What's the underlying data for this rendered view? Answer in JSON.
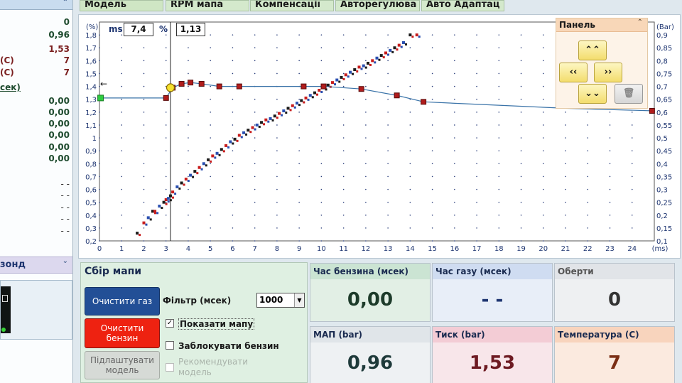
{
  "sidebar": {
    "rows": [
      {
        "label": "",
        "value": "0",
        "color": "#1e4b2e"
      },
      {
        "label": "",
        "value": "0,96",
        "color": "#1e4b2e"
      },
      {
        "label": "",
        "value": "1,53",
        "color": "#7a1f1f"
      },
      {
        "label": "(C)",
        "value": "7",
        "color": "#7a1f1f"
      },
      {
        "label": "(C)",
        "value": "7",
        "color": "#7a1f1f"
      },
      {
        "label": "сек)",
        "value": "",
        "color": "#1e4b2e"
      },
      {
        "label": "",
        "value": "0,00",
        "color": "#1e4b2e"
      },
      {
        "label": "",
        "value": "0,00",
        "color": "#1e4b2e"
      },
      {
        "label": "",
        "value": "0,00",
        "color": "#1e4b2e"
      },
      {
        "label": "",
        "value": "0,00",
        "color": "#1e4b2e"
      },
      {
        "label": "",
        "value": "0,00",
        "color": "#1e4b2e"
      },
      {
        "label": "",
        "value": "0,00",
        "color": "#1e4b2e"
      },
      {
        "label": "",
        "value": "- -",
        "color": "#333333"
      },
      {
        "label": "",
        "value": "- -",
        "color": "#333333"
      },
      {
        "label": "",
        "value": "- -",
        "color": "#333333"
      },
      {
        "label": "",
        "value": "- -",
        "color": "#333333"
      },
      {
        "label": "",
        "value": "- -",
        "color": "#333333"
      }
    ],
    "sonde_title": "зонд"
  },
  "tabs": [
    "Модель",
    "RPM мапа",
    "Компенсації",
    "Авторегулюва",
    "Авто Адаптац"
  ],
  "readout": {
    "ms_label": "ms",
    "ms_value": "7,4",
    "pct_label": "%",
    "pct_value": "1,13"
  },
  "panel": {
    "title": "Панель",
    "up": "⌃⌃",
    "left": "‹‹",
    "right": "››",
    "down": "⌄⌄",
    "trash": "🗑"
  },
  "chart_data": {
    "type": "scatter",
    "xlabel": "(ms)",
    "ylabel_left": "(%)",
    "ylabel_right": "(Bar)",
    "xlim": [
      0,
      25
    ],
    "ylim_left": [
      0.2,
      1.9
    ],
    "ylim_right": [
      0.1,
      0.95
    ],
    "x_ticks": [
      "0",
      "1",
      "2",
      "3",
      "4",
      "5",
      "6",
      "7",
      "8",
      "9",
      "10",
      "11",
      "12",
      "13",
      "14",
      "15",
      "16",
      "17",
      "18",
      "19",
      "20",
      "21",
      "22",
      "23",
      "24"
    ],
    "y_ticks_left": [
      "0,2",
      "0,3",
      "0,4",
      "0,5",
      "0,6",
      "0,7",
      "0,8",
      "0,9",
      "1",
      "1,1",
      "1,2",
      "1,3",
      "1,4",
      "1,5",
      "1,6",
      "1,7",
      "1,8"
    ],
    "y_ticks_right": [
      "0,1",
      "0,15",
      "0,2",
      "0,25",
      "0,3",
      "0,35",
      "0,4",
      "0,45",
      "0,5",
      "0,55",
      "0,6",
      "0,65",
      "0,7",
      "0,75",
      "0,8",
      "0,85",
      "0,9"
    ],
    "cursor": {
      "x": 3.2,
      "y": 1.39
    },
    "grid": true,
    "correction_line": {
      "x": [
        0,
        3.0,
        3.3,
        3.7,
        4.1,
        4.6,
        5.4,
        6.3,
        9.2,
        10.1,
        11.8,
        13.4,
        14.6,
        21.0,
        25.0
      ],
      "y": [
        1.31,
        1.31,
        1.39,
        1.42,
        1.43,
        1.42,
        1.4,
        1.4,
        1.4,
        1.4,
        1.38,
        1.33,
        1.28,
        1.23,
        1.21
      ]
    },
    "correction_points": {
      "x": [
        0.05,
        3.0,
        3.3,
        3.7,
        4.1,
        4.6,
        5.4,
        6.3,
        9.2,
        10.1,
        11.8,
        13.4,
        14.6,
        24.9
      ],
      "y": [
        1.31,
        1.31,
        1.39,
        1.42,
        1.43,
        1.42,
        1.4,
        1.4,
        1.4,
        1.4,
        1.38,
        1.33,
        1.28,
        1.21
      ]
    },
    "map_points": {
      "x": [
        1.7,
        2.0,
        2.2,
        2.4,
        2.5,
        2.7,
        2.9,
        3.0,
        3.1,
        3.2,
        3.3,
        3.5,
        3.7,
        3.9,
        4.1,
        4.3,
        4.5,
        4.7,
        4.9,
        5.1,
        5.3,
        5.5,
        5.7,
        5.9,
        6.1,
        6.3,
        6.5,
        6.7,
        6.9,
        7.1,
        7.3,
        7.5,
        7.7,
        7.9,
        8.1,
        8.3,
        8.5,
        8.7,
        8.9,
        9.1,
        9.3,
        9.5,
        9.7,
        9.9,
        10.1,
        10.3,
        10.5,
        10.7,
        10.9,
        11.1,
        11.3,
        11.5,
        11.7,
        11.9,
        12.1,
        12.3,
        12.5,
        12.7,
        12.9,
        13.1,
        13.3,
        13.5,
        13.7,
        14.0,
        14.3
      ],
      "y": [
        0.26,
        0.34,
        0.38,
        0.43,
        0.43,
        0.47,
        0.5,
        0.52,
        0.53,
        0.55,
        0.58,
        0.62,
        0.65,
        0.68,
        0.71,
        0.74,
        0.77,
        0.8,
        0.83,
        0.86,
        0.88,
        0.91,
        0.94,
        0.97,
        0.99,
        1.02,
        1.04,
        1.06,
        1.08,
        1.1,
        1.12,
        1.14,
        1.15,
        1.17,
        1.19,
        1.21,
        1.23,
        1.25,
        1.27,
        1.29,
        1.31,
        1.33,
        1.35,
        1.37,
        1.39,
        1.41,
        1.43,
        1.45,
        1.47,
        1.49,
        1.51,
        1.53,
        1.55,
        1.56,
        1.58,
        1.6,
        1.62,
        1.64,
        1.66,
        1.68,
        1.7,
        1.72,
        1.74,
        1.8,
        1.8
      ]
    }
  },
  "collect": {
    "title": "Сбір мапи",
    "clear_gas": "Очистити газ",
    "clear_petrol": "Очистити бензин",
    "setup_model": "Підлаштувати модель",
    "filter_label": "Фільтр (мсек)",
    "filter_value": "1000",
    "show_map": "Показати мапу",
    "show_map_checked": "✓",
    "block_petrol": "Заблокувати бензин",
    "recommend_model": "Рекомендувати модель"
  },
  "tiles": {
    "petrol_time": {
      "title": "Час бензина (мсек)",
      "value": "0,00"
    },
    "gas_time": {
      "title": "Час газу (мсек)",
      "value": "- -"
    },
    "rpm": {
      "title": "Оберти",
      "value": "0"
    },
    "map": {
      "title": "МАП (bar)",
      "value": "0,96"
    },
    "pressure": {
      "title": "Тиск (bar)",
      "value": "1,53"
    },
    "temperature": {
      "title": "Температура (С)",
      "value": "7"
    }
  }
}
